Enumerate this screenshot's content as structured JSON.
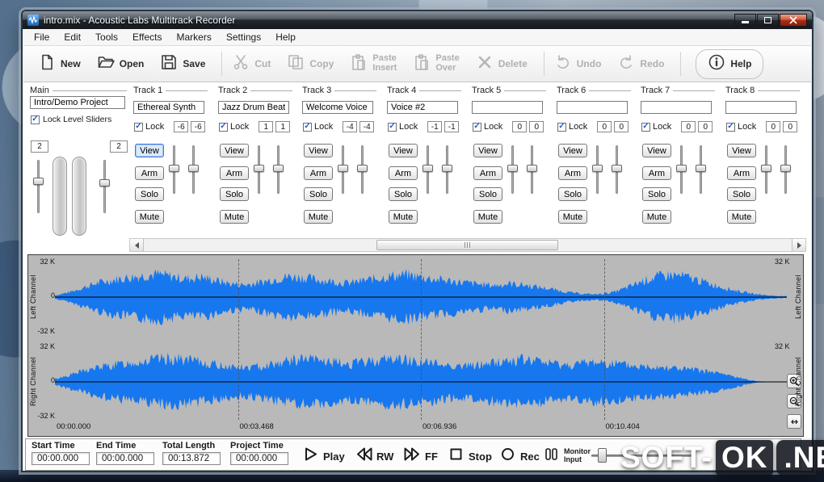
{
  "window": {
    "title": "intro.mix - Acoustic Labs Multitrack Recorder"
  },
  "menu_bar": {
    "items": [
      "File",
      "Edit",
      "Tools",
      "Effects",
      "Markers",
      "Settings",
      "Help"
    ]
  },
  "toolbar": {
    "buttons": [
      {
        "label": "New",
        "icon": "new-document-icon",
        "enabled": true
      },
      {
        "label": "Open",
        "icon": "open-folder-icon",
        "enabled": true
      },
      {
        "label": "Save",
        "icon": "save-disk-icon",
        "enabled": true
      },
      {
        "label": "Cut",
        "icon": "cut-scissors-icon",
        "enabled": false
      },
      {
        "label": "Copy",
        "icon": "copy-pages-icon",
        "enabled": false
      },
      {
        "label": "Paste",
        "label2": "Insert",
        "icon": "paste-clipboard-icon",
        "enabled": false
      },
      {
        "label": "Paste",
        "label2": "Over",
        "icon": "paste-clipboard-icon",
        "enabled": false
      },
      {
        "label": "Delete",
        "icon": "delete-x-icon",
        "enabled": false
      },
      {
        "label": "Undo",
        "icon": "undo-arrow-icon",
        "enabled": false
      },
      {
        "label": "Redo",
        "icon": "redo-arrow-icon",
        "enabled": false
      },
      {
        "label": "Help",
        "icon": "help-info-icon",
        "enabled": true
      }
    ],
    "separators_after": [
      2,
      7,
      9
    ]
  },
  "main_panel": {
    "label": "Main",
    "project_name": "Intro/Demo Project",
    "lock_label": "Lock Level Sliders",
    "lock_checked": true,
    "left_level": "2",
    "right_level": "2"
  },
  "lock_label": "Lock",
  "track_buttons": [
    "View",
    "Arm",
    "Solo",
    "Mute"
  ],
  "tracks": [
    {
      "label": "Track 1",
      "name": "Ethereal Synth",
      "locked": true,
      "left": "-6",
      "right": "-6",
      "view_active": true
    },
    {
      "label": "Track 2",
      "name": "Jazz Drum Beat",
      "locked": true,
      "left": "1",
      "right": "1",
      "view_active": false
    },
    {
      "label": "Track 3",
      "name": "Welcome Voice",
      "locked": true,
      "left": "-4",
      "right": "-4",
      "view_active": false
    },
    {
      "label": "Track 4",
      "name": "Voice #2",
      "locked": true,
      "left": "-1",
      "right": "-1",
      "view_active": false
    },
    {
      "label": "Track 5",
      "name": "",
      "locked": true,
      "left": "0",
      "right": "0",
      "view_active": false
    },
    {
      "label": "Track 6",
      "name": "",
      "locked": true,
      "left": "0",
      "right": "0",
      "view_active": false
    },
    {
      "label": "Track 7",
      "name": "",
      "locked": true,
      "left": "0",
      "right": "0",
      "view_active": false
    },
    {
      "label": "Track 8",
      "name": "",
      "locked": true,
      "left": "0",
      "right": "0",
      "view_active": false
    }
  ],
  "glyphs": {
    "check": "✓"
  },
  "waveform": {
    "channels": [
      "Left Channel",
      "Right Channel"
    ],
    "scale": [
      "32 K",
      "0",
      "-32 K"
    ],
    "time_labels": [
      "00:00.000",
      "00:03.468",
      "00:06.936",
      "00:10.404"
    ],
    "wave_color": "#1777ee",
    "envelope_left": [
      0.06,
      0.18,
      0.35,
      0.52,
      0.62,
      0.7,
      0.78,
      0.82,
      0.74,
      0.66,
      0.72,
      0.6,
      0.48,
      0.44,
      0.52,
      0.65,
      0.74,
      0.7,
      0.62,
      0.56,
      0.5,
      0.58,
      0.68,
      0.76,
      0.8,
      0.72,
      0.64,
      0.58,
      0.52,
      0.46,
      0.42,
      0.48,
      0.44,
      0.36,
      0.28,
      0.18,
      0.12,
      0.1,
      0.16,
      0.32,
      0.55,
      0.72,
      0.8,
      0.74,
      0.6,
      0.44,
      0.3,
      0.18,
      0.1,
      0.05,
      0.03
    ],
    "envelope_right": [
      0.1,
      0.25,
      0.4,
      0.52,
      0.6,
      0.68,
      0.74,
      0.8,
      0.84,
      0.78,
      0.7,
      0.62,
      0.56,
      0.5,
      0.56,
      0.66,
      0.76,
      0.82,
      0.78,
      0.7,
      0.64,
      0.7,
      0.78,
      0.84,
      0.8,
      0.72,
      0.66,
      0.6,
      0.56,
      0.62,
      0.7,
      0.76,
      0.8,
      0.74,
      0.66,
      0.6,
      0.66,
      0.72,
      0.68,
      0.6,
      0.54,
      0.58,
      0.52,
      0.46,
      0.4,
      0.34,
      0.24,
      0.12,
      0.02,
      0.01,
      0.01
    ]
  },
  "transport": {
    "fields": [
      {
        "label": "Start Time",
        "value": "00:00.000"
      },
      {
        "label": "End Time",
        "value": "00:00.000"
      },
      {
        "label": "Total Length",
        "value": "00:13.872"
      },
      {
        "label": "Project Time",
        "value": "00:00.000"
      }
    ],
    "buttons": [
      {
        "label": "Play",
        "icon": "play-icon"
      },
      {
        "label": "RW",
        "icon": "rewind-icon"
      },
      {
        "label": "FF",
        "icon": "fast-forward-icon"
      },
      {
        "label": "Stop",
        "icon": "stop-icon"
      },
      {
        "label": "Rec",
        "icon": "record-icon"
      },
      {
        "label": "Monitor",
        "label2": "Input",
        "icon": "monitor-input-icon"
      }
    ]
  },
  "watermark": {
    "part1": "SOFT-",
    "part2": "OK",
    "part3": ".NET"
  }
}
